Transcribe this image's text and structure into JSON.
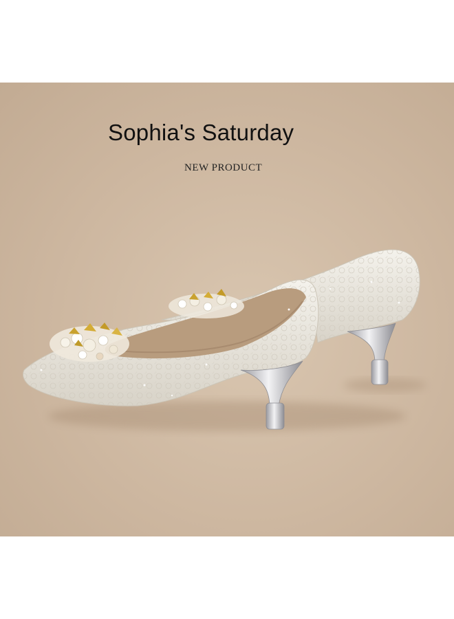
{
  "banner": {
    "brand_name": "Sophia's Saturday",
    "tagline": "NEW PRODUCT"
  },
  "colors": {
    "background": "#cdb7a0",
    "shoe_body": "#ece8df",
    "shoe_lining": "#b89c7e",
    "embellishment_gold": "#c9a230",
    "heel_silver": "#d8d8dc"
  }
}
